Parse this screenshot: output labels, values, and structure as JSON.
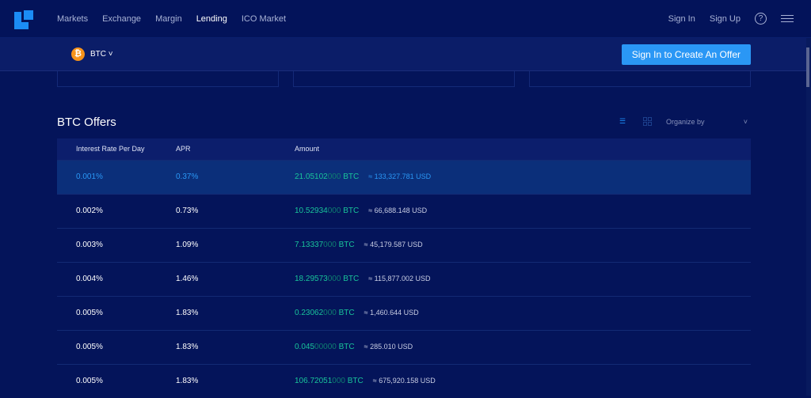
{
  "nav": {
    "items": [
      "Markets",
      "Exchange",
      "Margin",
      "Lending",
      "ICO Market"
    ],
    "active": "Lending",
    "sign_in": "Sign In",
    "sign_up": "Sign Up",
    "help": "?"
  },
  "sub": {
    "coin": "BTC",
    "cta": "Sign In to Create An Offer"
  },
  "offers": {
    "title": "BTC Offers",
    "organize": "Organize by",
    "columns": [
      "Interest Rate Per Day",
      "APR",
      "Amount"
    ],
    "rows": [
      {
        "rate": "0.001%",
        "apr": "0.37%",
        "amt": "21.05102",
        "zeros": "000",
        "unit": "BTC",
        "usd": "≈ 133,327.781 USD"
      },
      {
        "rate": "0.002%",
        "apr": "0.73%",
        "amt": "10.52934",
        "zeros": "000",
        "unit": "BTC",
        "usd": "≈ 66,688.148 USD"
      },
      {
        "rate": "0.003%",
        "apr": "1.09%",
        "amt": "7.13337",
        "zeros": "000",
        "unit": "BTC",
        "usd": "≈ 45,179.587 USD"
      },
      {
        "rate": "0.004%",
        "apr": "1.46%",
        "amt": "18.29573",
        "zeros": "000",
        "unit": "BTC",
        "usd": "≈ 115,877.002 USD"
      },
      {
        "rate": "0.005%",
        "apr": "1.83%",
        "amt": "0.23062",
        "zeros": "000",
        "unit": "BTC",
        "usd": "≈ 1,460.644 USD"
      },
      {
        "rate": "0.005%",
        "apr": "1.83%",
        "amt": "0.045",
        "zeros": "00000",
        "unit": "BTC",
        "usd": "≈ 285.010 USD"
      },
      {
        "rate": "0.005%",
        "apr": "1.83%",
        "amt": "106.72051",
        "zeros": "000",
        "unit": "BTC",
        "usd": "≈ 675,920.158 USD"
      }
    ]
  }
}
